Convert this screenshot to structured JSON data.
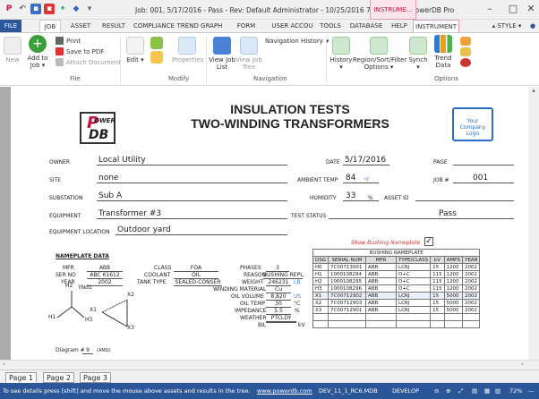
{
  "window": {
    "title": "Job: 001, 5/17/2016 - Pass - Rev: Default Administrator - 10/25/2016 7:50:17 AM - PowerDB Pro",
    "context_tab": "INSTRUME..."
  },
  "tabs": [
    "FILE",
    "JOB",
    "ASSET",
    "RESULT",
    "COMPLIANCE",
    "TREND GRAPH",
    "FORM LIBRARY",
    "USER ACCOU",
    "TOOLS",
    "DATABASE",
    "HELP",
    "INSTRUMENT"
  ],
  "style_label": "STYLE",
  "ribbon": {
    "new": "New",
    "add_to_job": "Add to Job",
    "print": "Print",
    "save_pdf": "Save to PDF",
    "attach": "Attach Document",
    "edit": "Edit",
    "properties": "Properties",
    "view_job_list": "View Job List",
    "view_job_tree": "View Job Tree",
    "nav_history": "Navigation History",
    "history": "History",
    "region": "Region/Sort/Filter Options",
    "synch": "Synch",
    "trend_data": "Trend Data",
    "groups": {
      "file": "File",
      "modify": "Modify",
      "navigation": "Navigation",
      "options": "Options"
    }
  },
  "form": {
    "title1": "INSULATION TESTS",
    "title2": "TWO-WINDING TRANSFORMERS",
    "logo_text": "Your Company Logo",
    "owner_label": "OWNER",
    "owner": "Local Utility",
    "site_label": "SITE",
    "site": "none",
    "sub_label": "SUBSTATION",
    "substation": "Sub A",
    "equip_label": "EQUIPMENT",
    "equipment": "Transformer #3",
    "loc_label": "EQUIPMENT LOCATION",
    "location": "Outdoor yard",
    "date_label": "DATE",
    "date": "5/17/2016",
    "page_label": "PAGE",
    "amb_label": "AMBIENT TEMP",
    "amb": "84",
    "amb_unit": "°F",
    "job_label": "JOB #",
    "job": "001",
    "hum_label": "HUMIDITY",
    "hum": "33",
    "hum_unit": "%",
    "asset_label": "ASSET ID",
    "status_label": "TEST STATUS",
    "status": "Pass",
    "show_bushing": "Show Bushing Nameplate"
  },
  "nameplate": {
    "heading": "NAMEPLATE DATA",
    "mfr_l": "MFR",
    "mfr": "ABB",
    "ser_l": "SER NO",
    "ser": "ABC 61612",
    "year_l": "YEAR",
    "year": "2002",
    "class_l": "CLASS",
    "class": "FOA",
    "coolant_l": "COOLANT",
    "coolant": "OIL",
    "tank_l": "TANK TYPE",
    "tank": "SEALED-CONSER",
    "phases_l": "PHASES",
    "phases": "3",
    "reason_l": "REASON",
    "reason": "BUSHING REPL.",
    "weight_l": "WEIGHT",
    "weight": "246231",
    "weight_u": "LB",
    "wind_l": "WINDING MATERIAL",
    "wind": "Cu",
    "oilvol_l": "OIL VOLUME",
    "oilvol": "8,820",
    "oilvol_u": "US",
    "oiltemp_l": "OIL TEMP",
    "oiltemp": "30",
    "oiltemp_u": "°C",
    "imp_l": "IMPEDANCE",
    "imp": "5.5",
    "imp_u": "%",
    "weather_l": "WEATHER",
    "weather": "PTCLDY",
    "bil_l": "BIL",
    "bil_u": "kV",
    "vector": "YNd1",
    "diagram_l": "Diagram #",
    "diagram": "9",
    "ansi": "(ANSI)",
    "h1": "H1",
    "h2": "H2",
    "h3": "H3",
    "x1": "X1",
    "x2": "X2",
    "x3": "X3"
  },
  "bushing": {
    "title": "BUSHING NAMEPLATE",
    "headers": [
      "DSG",
      "SERIAL NUM",
      "MFR",
      "TYPE/CLASS",
      "kV",
      "AMPS",
      "YEAR"
    ],
    "rows": [
      [
        "H0",
        "7C00713001",
        "ABB",
        "LCRJ",
        "15",
        "1200",
        "2002"
      ],
      [
        "H1",
        "1000108294",
        "ABB",
        "O+C",
        "115",
        "1200",
        "2002"
      ],
      [
        "H2",
        "1000108295",
        "ABB",
        "O+C",
        "115",
        "1200",
        "2002"
      ],
      [
        "H3",
        "1000108296",
        "ABB",
        "O+C",
        "115",
        "1200",
        "2002"
      ],
      [
        "X1",
        "7C00712902",
        "ABB",
        "LCRJ",
        "15",
        "5000",
        "2002"
      ],
      [
        "X2",
        "7C00712903",
        "ABB",
        "LCRJ",
        "15",
        "5000",
        "2002"
      ],
      [
        "X3",
        "7C00712901",
        "ABB",
        "LCRJ",
        "15",
        "5000",
        "2002"
      ],
      [
        "",
        "",
        "",
        "",
        "",
        "",
        ""
      ],
      [
        "",
        "",
        "",
        "",
        "",
        "",
        ""
      ]
    ]
  },
  "sheets": [
    "Page 1",
    "Page 2",
    "Page 3"
  ],
  "statusbar": {
    "hint": "To see details press [shift] and move the mouse above assets and results in the tree.",
    "url": "www.powerdb.com",
    "db": "DEV_11_1_RC6.MDB",
    "mode": "DEVELOP",
    "zoom": "72%"
  }
}
